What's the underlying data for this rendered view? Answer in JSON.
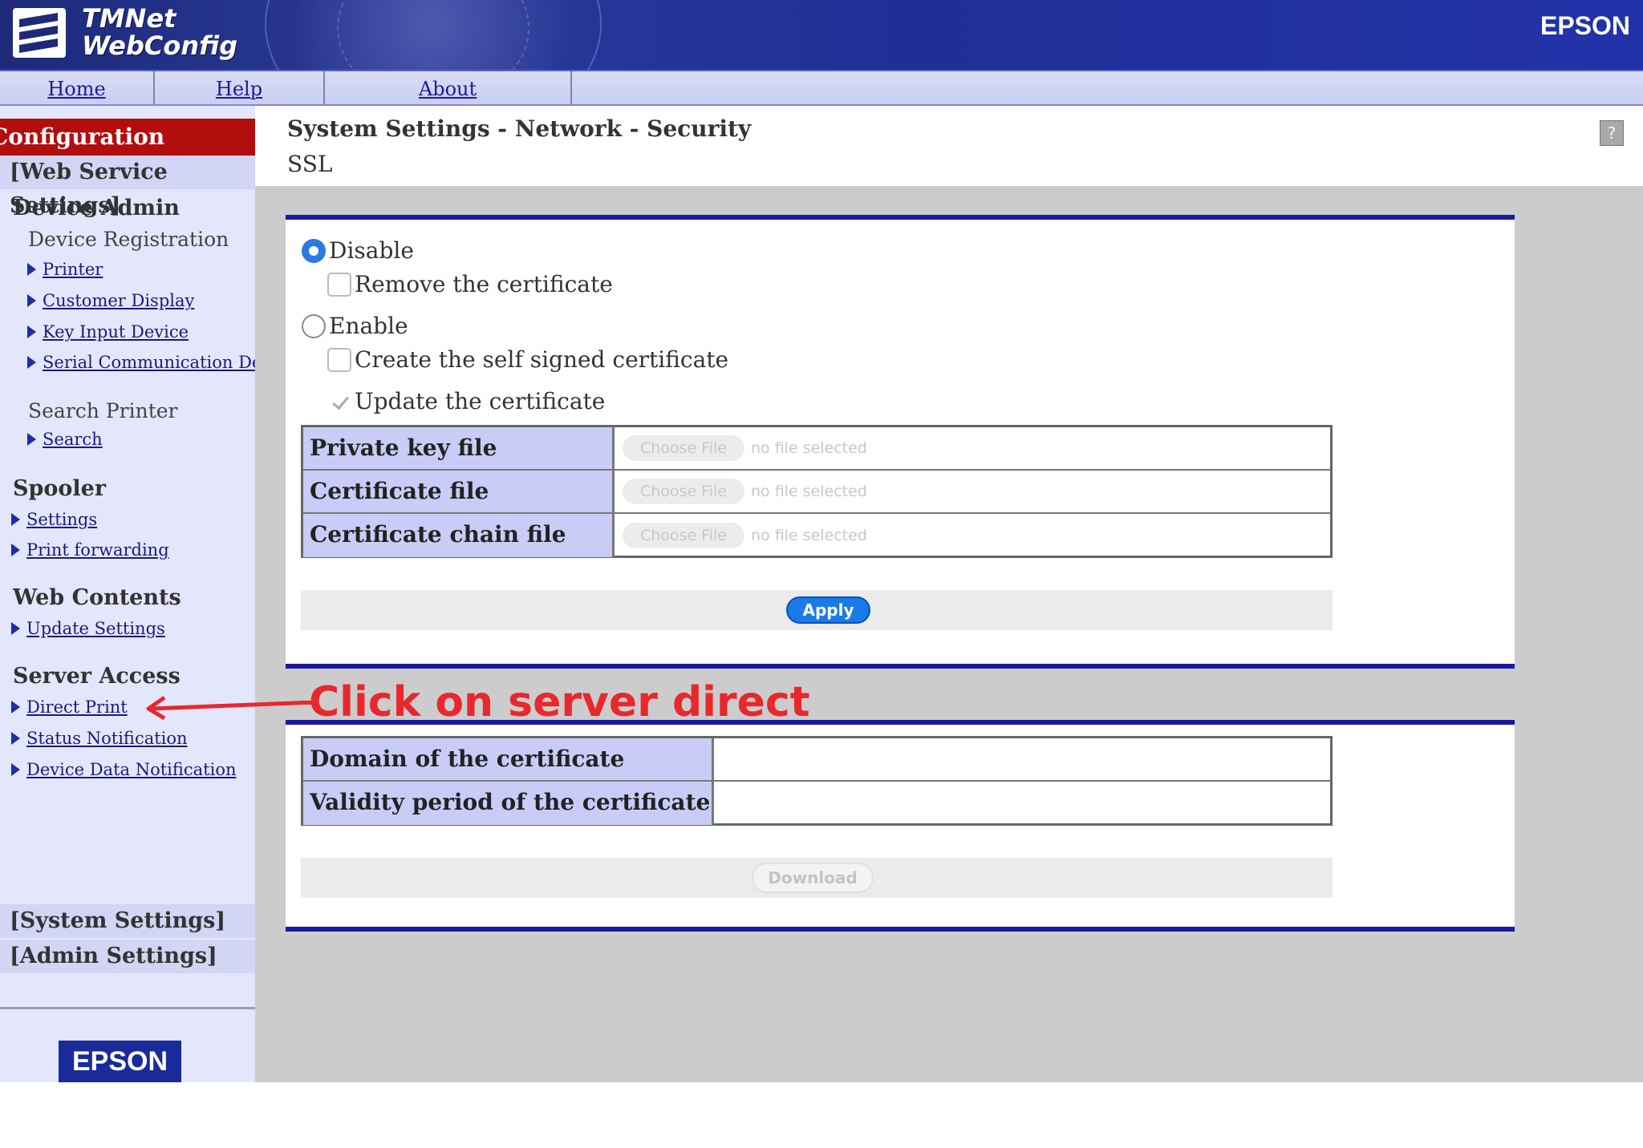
{
  "header": {
    "brand_line1": "TMNet",
    "brand_line2": "WebConfig",
    "epson_label": "EPSON"
  },
  "nav": {
    "home": "Home",
    "help": "Help",
    "about": "About"
  },
  "sidebar": {
    "config_title": "Configuration",
    "web_service_settings": "[Web Service Settings]",
    "device_admin": "Device Admin",
    "device_registration": "Device Registration",
    "links_device": [
      "Printer",
      "Customer Display",
      "Key Input Device",
      "Serial Communication Devi"
    ],
    "search_printer": "Search Printer",
    "search_link": "Search",
    "spooler": "Spooler",
    "links_spooler": [
      "Settings",
      "Print forwarding"
    ],
    "web_contents": "Web Contents",
    "update_settings": "Update Settings",
    "server_access": "Server Access",
    "links_server": [
      "Direct Print",
      "Status Notification",
      "Device Data Notification"
    ],
    "system_settings": "[System Settings]",
    "admin_settings": "[Admin Settings]",
    "footer_logo": "EPSON"
  },
  "main": {
    "breadcrumb": "System Settings - Network - Security",
    "subtitle": "SSL",
    "help_icon_glyph": "?",
    "options": {
      "disable": "Disable",
      "remove_cert": "Remove the certificate",
      "enable": "Enable",
      "create_self_signed": "Create the self signed certificate",
      "update_cert": "Update the certificate",
      "selected": "disable"
    },
    "file_rows": [
      {
        "label": "Private key file",
        "button": "Choose File",
        "status": "no file selected"
      },
      {
        "label": "Certificate file",
        "button": "Choose File",
        "status": "no file selected"
      },
      {
        "label": "Certificate chain file",
        "button": "Choose File",
        "status": "no file selected"
      }
    ],
    "apply_label": "Apply",
    "cert_rows": [
      {
        "label": "Domain of the certificate",
        "value": ""
      },
      {
        "label": "Validity period of the certificate",
        "value": ""
      }
    ],
    "download_label": "Download"
  },
  "annotation": {
    "text": "Click on server direct",
    "color": "#e8282c"
  },
  "colors": {
    "header_blue": "#1d2a7a",
    "config_red": "#b30e0e",
    "panel_border": "#1a1aa0",
    "apply_blue": "#1a7be8"
  }
}
